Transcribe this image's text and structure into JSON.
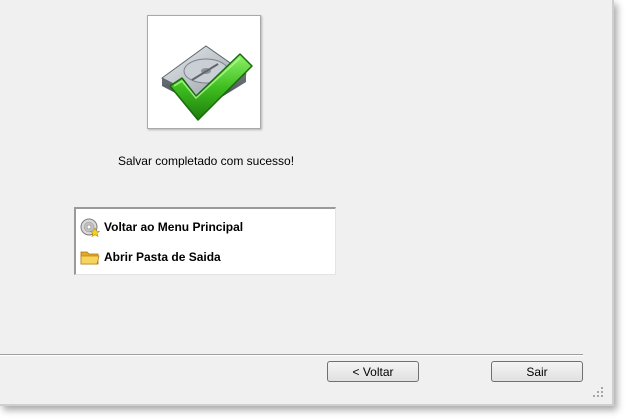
{
  "status_message": "Salvar completado com sucesso!",
  "hero": {
    "icon": "hard-disk-check-icon"
  },
  "actions": [
    {
      "label": "Voltar ao Menu Principal",
      "icon": "disc-star-icon"
    },
    {
      "label": "Abrir Pasta de Saida",
      "icon": "folder-icon"
    }
  ],
  "buttons": {
    "back_label": "< Voltar",
    "exit_label": "Sair"
  },
  "colors": {
    "window_bg": "#f0f0f0",
    "check_green": "#3fbf1f",
    "folder_yellow": "#f3c53a"
  }
}
